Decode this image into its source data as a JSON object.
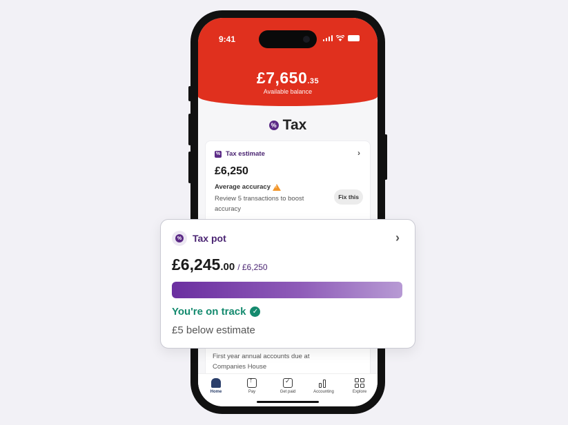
{
  "status_bar": {
    "time": "9:41"
  },
  "header": {
    "balance_main": "£7,650",
    "balance_pence": ".35",
    "balance_label": "Available balance",
    "color": "#e0301e"
  },
  "page": {
    "title": "Tax",
    "title_icon": "percent-icon"
  },
  "tax_estimate": {
    "label": "Tax estimate",
    "amount": "£6,250",
    "accuracy_label": "Average accuracy",
    "accuracy_description": "Review 5 transactions to boost accuracy",
    "fix_button": "Fix this"
  },
  "accounts_card": {
    "text": "First year annual accounts due at Companies House"
  },
  "tab_bar": {
    "items": [
      {
        "label": "Home",
        "icon": "home-icon",
        "active": true
      },
      {
        "label": "Pay",
        "icon": "pay-icon"
      },
      {
        "label": "Get paid",
        "icon": "get-paid-icon"
      },
      {
        "label": "Accounting",
        "icon": "accounting-icon"
      },
      {
        "label": "Explore",
        "icon": "explore-icon"
      }
    ]
  },
  "tax_pot": {
    "label": "Tax pot",
    "amount_main": "£6,245",
    "amount_pence": ".00",
    "target": "/ £6,250",
    "progress_fraction": 0.999,
    "status": "You're on track",
    "below_estimate": "£5 below estimate",
    "accent_color": "#4a2472",
    "status_color": "#148a6e"
  }
}
